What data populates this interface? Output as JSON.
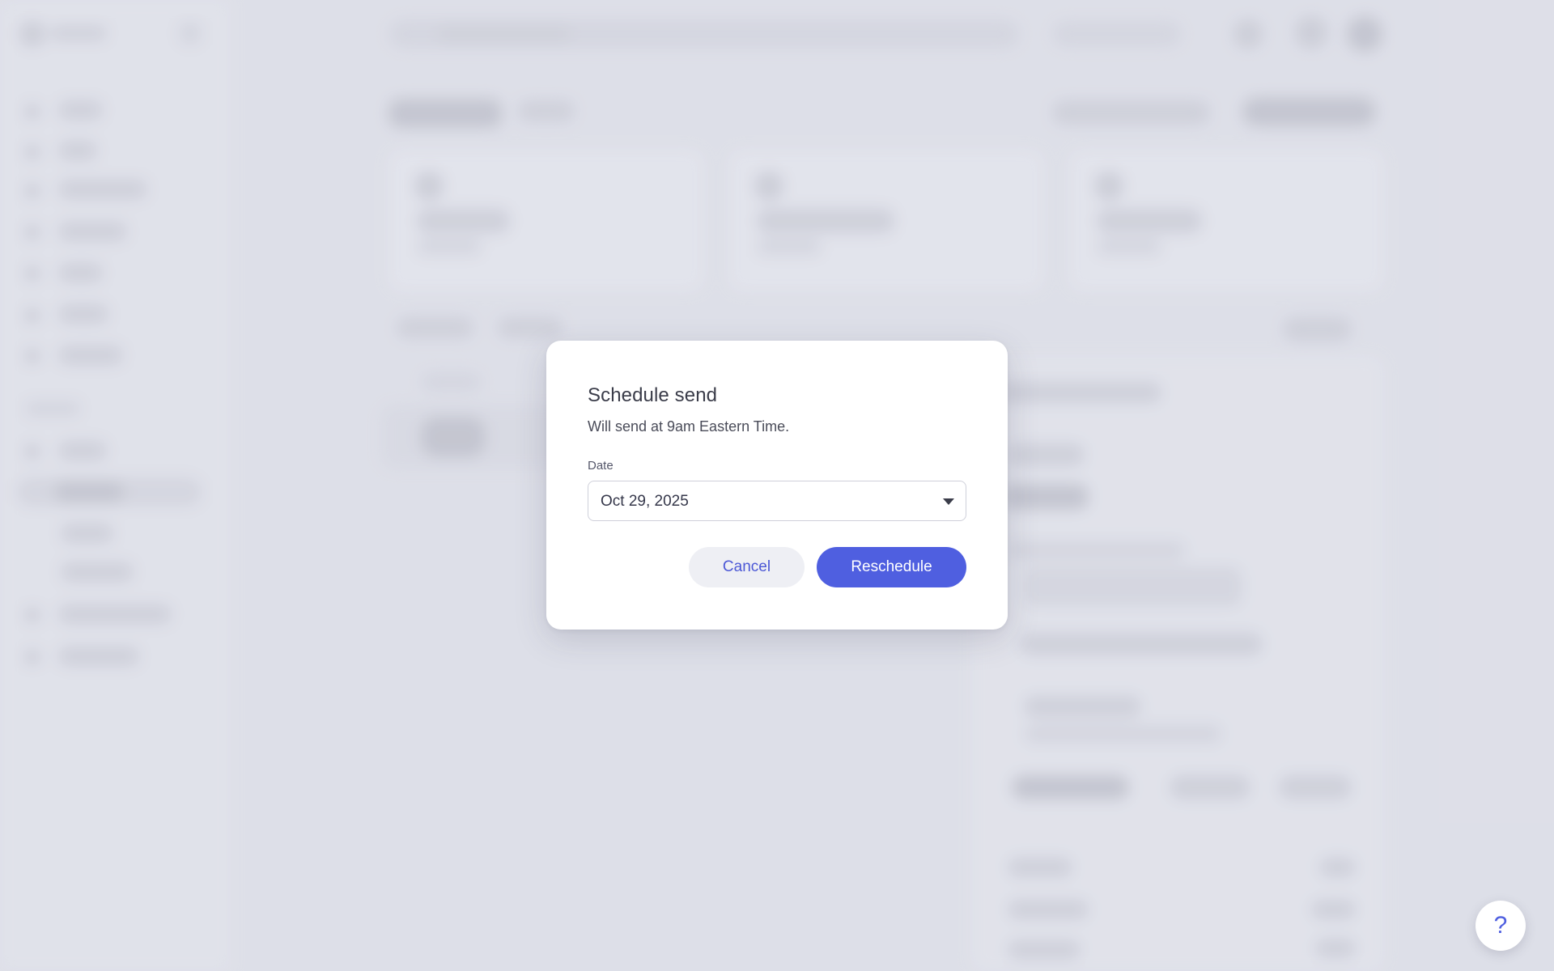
{
  "dialog": {
    "title": "Schedule send",
    "subtitle": "Will send at 9am Eastern Time.",
    "date_label": "Date",
    "date_value": "Oct 29, 2025",
    "cancel_label": "Cancel",
    "confirm_label": "Reschedule"
  },
  "help": {
    "glyph": "?"
  },
  "colors": {
    "accent": "#4f5fe0",
    "backdrop": "#dedfe8",
    "cancel_bg": "#eeeff4"
  },
  "icons": {
    "date_dropdown": "caret-down-icon",
    "help": "help-icon"
  }
}
